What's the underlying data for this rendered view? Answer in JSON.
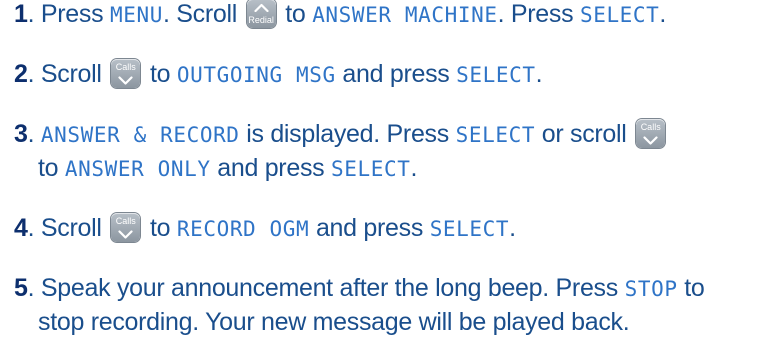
{
  "steps": [
    {
      "number": "1",
      "t1": "Press",
      "c1": "MENU",
      "t2": "Scroll",
      "key_label": "Redial",
      "t3": "to",
      "c2": "ANSWER MACHINE",
      "t4": "Press",
      "c3": "SELECT"
    },
    {
      "number": "2",
      "t1": "Scroll",
      "key_label": "Calls",
      "t2": "to",
      "c1": "OUTGOING MSG",
      "t3": "and press",
      "c2": "SELECT"
    },
    {
      "number": "3",
      "c1": "ANSWER & RECORD",
      "t1": "is displayed. Press",
      "c2": "SELECT",
      "t2": "or scroll",
      "key_label": "Calls",
      "t3": "to",
      "c3": "ANSWER ONLY",
      "t4": "and press",
      "c4": "SELECT"
    },
    {
      "number": "4",
      "t1": "Scroll",
      "key_label": "Calls",
      "t2": "to",
      "c1": "RECORD OGM",
      "t3": "and press",
      "c2": "SELECT"
    },
    {
      "number": "5",
      "t1": "Speak your announcement after the long beep. Press",
      "c1": "STOP",
      "t2": "to",
      "t3": "stop recording. Your new message will be played back."
    }
  ],
  "colors": {
    "text": "#1a4e8c",
    "number": "#0d2f6e",
    "lcd_text": "#2f74c7",
    "key_bg": "#9aa3ac"
  },
  "icons": {
    "redial_key": "chevron-up-icon",
    "calls_key": "chevron-down-icon"
  }
}
